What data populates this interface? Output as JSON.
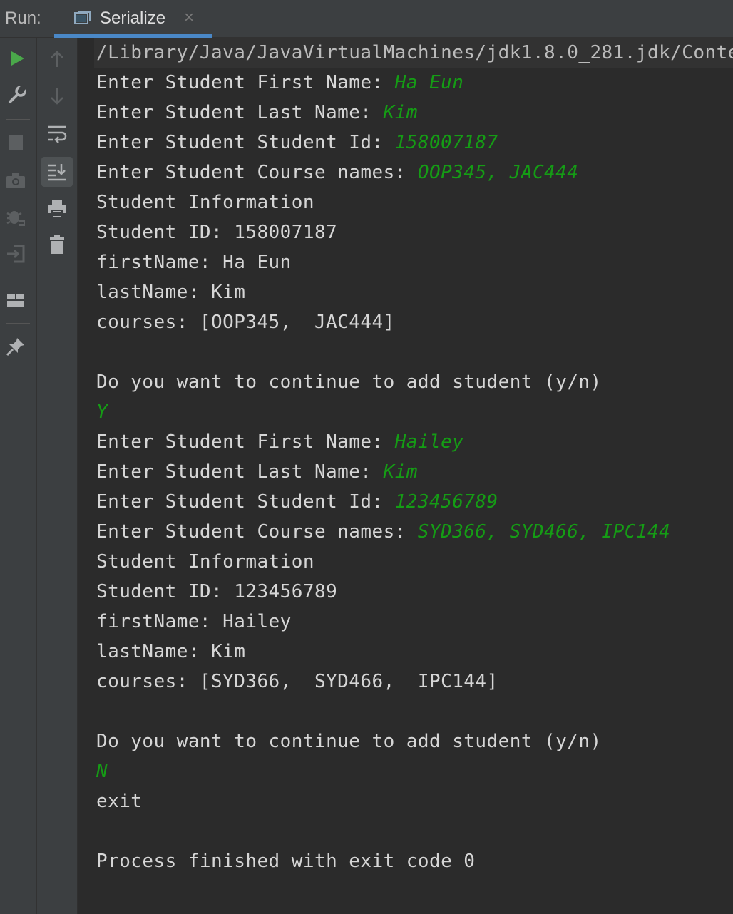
{
  "header": {
    "run_label": "Run:",
    "tab_label": "Serialize",
    "close_glyph": "×"
  },
  "colors": {
    "background": "#2b2b2b",
    "panel": "#3c3f41",
    "output_text": "#d6d6d6",
    "user_input": "#159c15",
    "tab_underline": "#4a88c7",
    "run_icon": "#4aa84a"
  },
  "toolbar_left": [
    "run-icon",
    "wrench-icon",
    "stop-icon",
    "camera-icon",
    "debug-bug-icon",
    "exit-icon",
    "layout-icon",
    "pin-icon"
  ],
  "toolbar_right": [
    "up-arrow-icon",
    "down-arrow-icon",
    "soft-wrap-icon",
    "scroll-to-end-icon",
    "print-icon",
    "trash-icon"
  ],
  "console": {
    "command": "/Library/Java/JavaVirtualMachines/jdk1.8.0_281.jdk/Conte",
    "lines": [
      {
        "prompt": "Enter Student First Name: ",
        "input": "Ha Eun"
      },
      {
        "prompt": "Enter Student Last Name: ",
        "input": "Kim"
      },
      {
        "prompt": "Enter Student Student Id: ",
        "input": "158007187"
      },
      {
        "prompt": "Enter Student Course names: ",
        "input": "OOP345, JAC444"
      },
      {
        "prompt": "Student Information",
        "input": ""
      },
      {
        "prompt": "Student ID: 158007187",
        "input": ""
      },
      {
        "prompt": "firstName: Ha Eun",
        "input": ""
      },
      {
        "prompt": "lastName: Kim",
        "input": ""
      },
      {
        "prompt": "courses: [OOP345,  JAC444]",
        "input": ""
      },
      {
        "prompt": "",
        "input": ""
      },
      {
        "prompt": "Do you want to continue to add student (y/n)",
        "input": ""
      },
      {
        "prompt": "",
        "input": "Y"
      },
      {
        "prompt": "Enter Student First Name: ",
        "input": "Hailey"
      },
      {
        "prompt": "Enter Student Last Name: ",
        "input": "Kim"
      },
      {
        "prompt": "Enter Student Student Id: ",
        "input": "123456789"
      },
      {
        "prompt": "Enter Student Course names: ",
        "input": "SYD366, SYD466, IPC144"
      },
      {
        "prompt": "Student Information",
        "input": ""
      },
      {
        "prompt": "Student ID: 123456789",
        "input": ""
      },
      {
        "prompt": "firstName: Hailey",
        "input": ""
      },
      {
        "prompt": "lastName: Kim",
        "input": ""
      },
      {
        "prompt": "courses: [SYD366,  SYD466,  IPC144]",
        "input": ""
      },
      {
        "prompt": "",
        "input": ""
      },
      {
        "prompt": "Do you want to continue to add student (y/n)",
        "input": ""
      },
      {
        "prompt": "",
        "input": "N"
      },
      {
        "prompt": "exit",
        "input": ""
      },
      {
        "prompt": "",
        "input": ""
      },
      {
        "prompt": "Process finished with exit code 0",
        "input": ""
      }
    ]
  }
}
